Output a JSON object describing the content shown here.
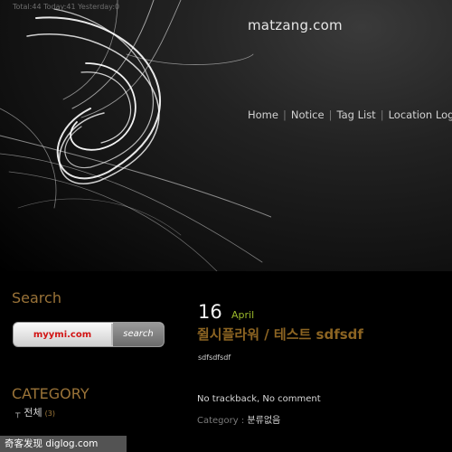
{
  "header": {
    "stats": "Total:44 Today:41 Yesterday:0",
    "site_title": "matzang.com"
  },
  "nav": {
    "items": [
      {
        "label": "Home"
      },
      {
        "label": "Notice"
      },
      {
        "label": "Tag List"
      },
      {
        "label": "Location Log"
      }
    ],
    "separator": "|"
  },
  "sidebar": {
    "search_title": "Search",
    "search_input_label": "myymi.com",
    "search_button_label": "search",
    "category_title": "CATEGORY",
    "category_items": [
      {
        "label": "전체",
        "count": "(3)"
      }
    ]
  },
  "post": {
    "day": "16",
    "month": "April",
    "title": "쥘시플라워 / 테스트 sdfsdf",
    "body": "sdfsdfsdf",
    "trackback_label": "No trackback",
    "meta_separator": ",",
    "comment_label": "No comment",
    "category_label": "Category :",
    "category_value": "분류없음"
  },
  "watermark": "奇客发现 diglog.com",
  "colors": {
    "accent": "#9a7338",
    "month_green": "#9bb92b",
    "search_red": "#d21414"
  }
}
